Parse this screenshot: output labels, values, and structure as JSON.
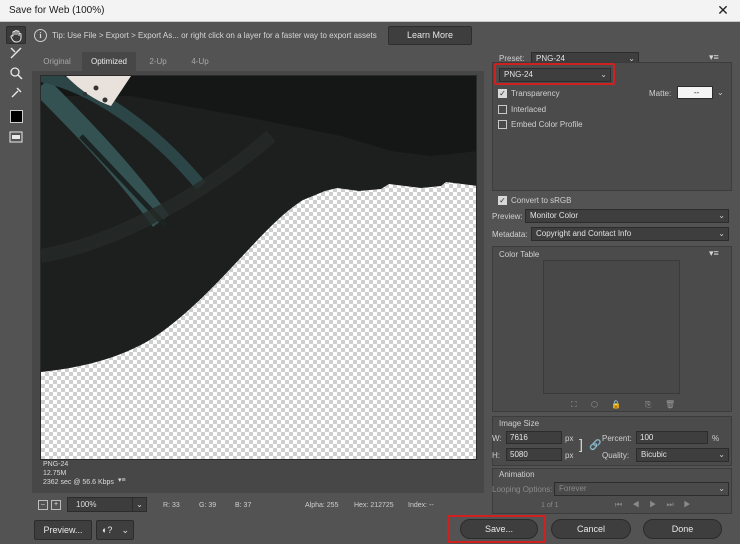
{
  "window": {
    "title": "Save for Web (100%)"
  },
  "tools": [
    {
      "icon": "hand-icon",
      "glyph": "✋"
    },
    {
      "icon": "slice-select-icon",
      "glyph": "⤢"
    },
    {
      "icon": "zoom-icon",
      "glyph": "🔍"
    },
    {
      "icon": "eyedropper-icon",
      "glyph": "✎"
    },
    {
      "icon": "eyedropper-color-icon",
      "glyph": ""
    },
    {
      "icon": "toggle-slices-icon",
      "glyph": "▭"
    }
  ],
  "tip": {
    "text": "Tip: Use File > Export > Export As...  or right click on a layer for a faster way to export assets",
    "learn_more": "Learn More"
  },
  "tabs": [
    "Original",
    "Optimized",
    "2-Up",
    "4-Up"
  ],
  "image_meta": {
    "format": "PNG-24",
    "size": "12.75M",
    "time": "2362 sec @ 56.6 Kbps"
  },
  "status": {
    "zoom": "100%",
    "r": "R: 33",
    "g": "G: 39",
    "b": "B: 37",
    "alpha": "Alpha: 255",
    "hex": "Hex: 212725",
    "index": "Index: --"
  },
  "right": {
    "preset_label": "Preset:",
    "preset_value": "PNG-24",
    "format_value": "PNG-24",
    "transparency": "Transparency",
    "matte_label": "Matte:",
    "matte_value": "--",
    "interlaced": "Interlaced",
    "embed_profile": "Embed Color Profile",
    "convert_srgb": "Convert to sRGB",
    "preview_label": "Preview:",
    "preview_value": "Monitor Color",
    "metadata_label": "Metadata:",
    "metadata_value": "Copyright and Contact Info",
    "color_table": "Color Table",
    "image_size": "Image Size",
    "w_label": "W:",
    "w_value": "7616",
    "h_label": "H:",
    "h_value": "5080",
    "px": "px",
    "percent_label": "Percent:",
    "percent_value": "100",
    "percent_unit": "%",
    "quality_label": "Quality:",
    "quality_value": "Bicubic",
    "animation": "Animation",
    "looping_label": "Looping Options:",
    "looping_value": "Forever",
    "frame_counter": "1 of 1"
  },
  "buttons": {
    "preview": "Preview...",
    "save": "Save...",
    "cancel": "Cancel",
    "done": "Done"
  },
  "colors": {
    "highlight_red": "#d0201f"
  }
}
